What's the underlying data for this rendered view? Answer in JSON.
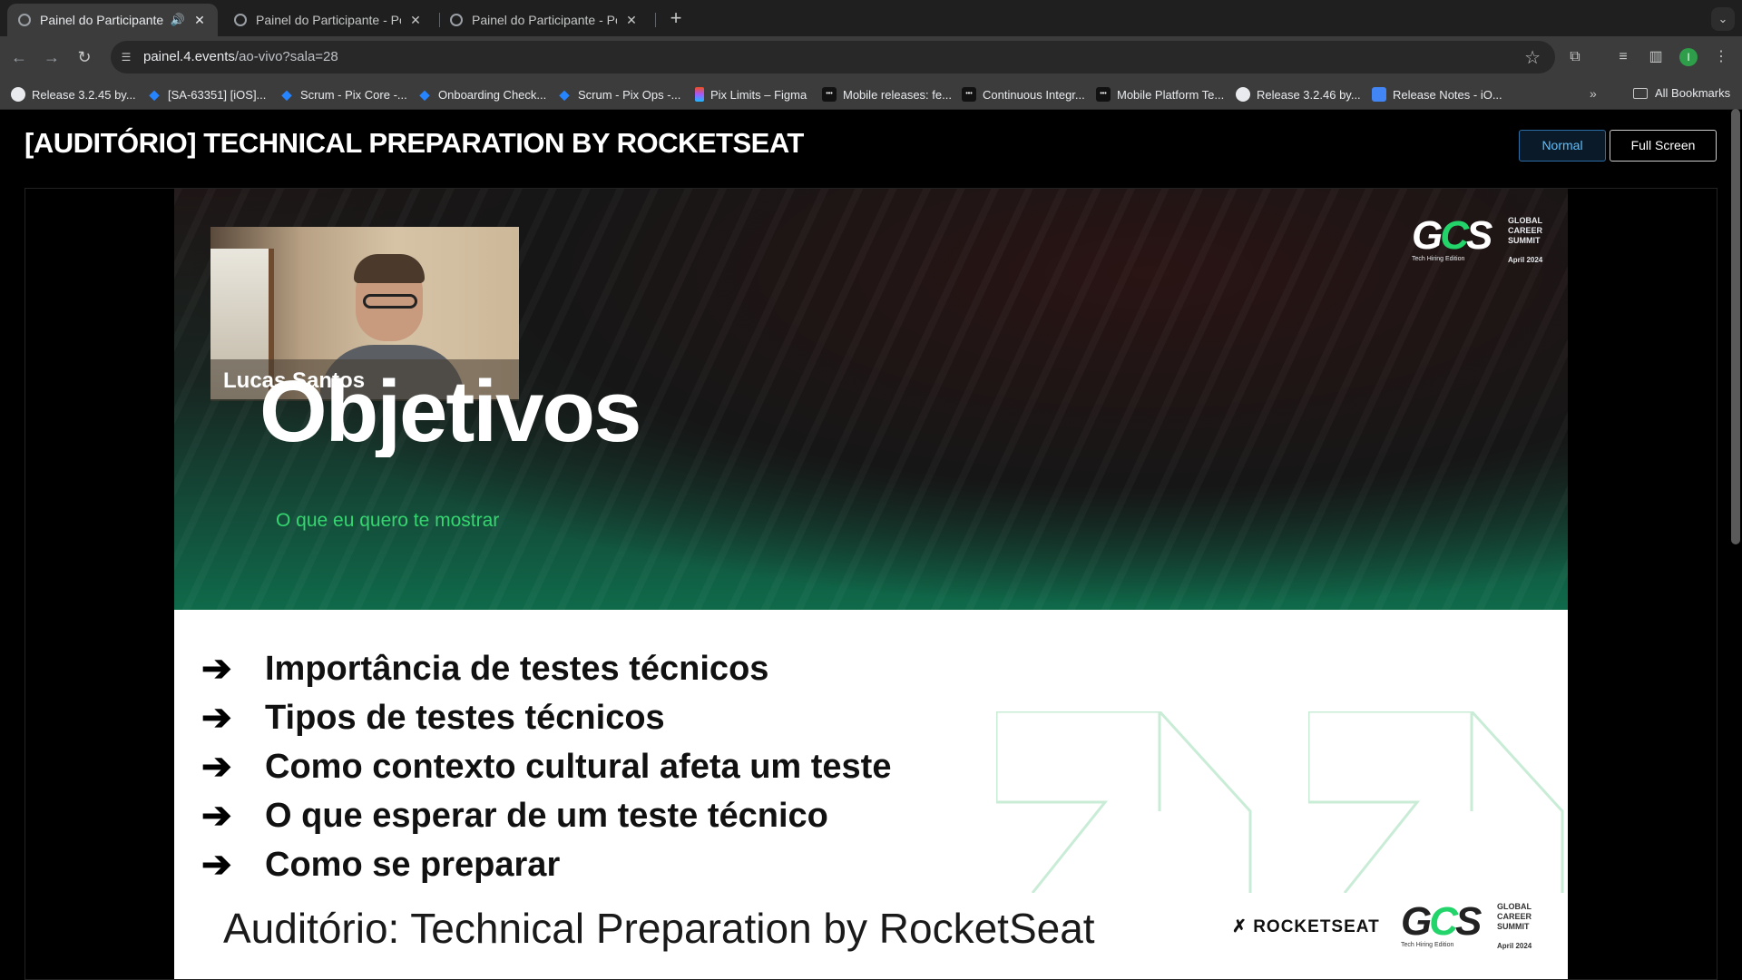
{
  "tabs": [
    {
      "title": "Painel do Participante - P",
      "active": true,
      "audio": true
    },
    {
      "title": "Painel do Participante - Powe",
      "active": false
    },
    {
      "title": "Painel do Participante - Powe",
      "active": false
    }
  ],
  "address": {
    "host": "painel.4.events",
    "path": "/ao-vivo?sala=28"
  },
  "profile_initial": "I",
  "bookmarks": [
    {
      "label": "Release 3.2.45 by...",
      "icon": "github-icon"
    },
    {
      "label": "[SA-63351] [iOS]...",
      "icon": "jira-icon"
    },
    {
      "label": "Scrum - Pix Core -...",
      "icon": "jira-icon"
    },
    {
      "label": "Onboarding Check...",
      "icon": "jira-icon"
    },
    {
      "label": "Scrum - Pix Ops -...",
      "icon": "jira-icon"
    },
    {
      "label": "Pix Limits – Figma",
      "icon": "figma-icon"
    },
    {
      "label": "Mobile releases: fe...",
      "icon": "app-icon"
    },
    {
      "label": "Continuous Integr...",
      "icon": "app-icon"
    },
    {
      "label": "Mobile Platform Te...",
      "icon": "app-icon"
    },
    {
      "label": "Release 3.2.46 by...",
      "icon": "github-icon"
    },
    {
      "label": "Release Notes - iO...",
      "icon": "docs-icon"
    }
  ],
  "all_bookmarks": "All Bookmarks",
  "page": {
    "title": "[AUDITÓRIO] TECHNICAL PREPARATION BY ROCKETSEAT",
    "btn_normal": "Normal",
    "btn_fullscreen": "Full Screen"
  },
  "slide": {
    "speaker": "Lucas Santos",
    "heading": "Objetivos",
    "subtitle": "O que eu quero te mostrar",
    "bullets": [
      "Importância de testes técnicos",
      "Tipos de testes técnicos",
      "Como contexto cultural afeta um teste",
      "O que esperar de um teste técnico",
      "Como se preparar"
    ],
    "footer": "Auditório: Technical Preparation by RocketSeat",
    "sponsor": "ROCKETSEAT",
    "logo": {
      "mark_g": "G",
      "mark_c": "C",
      "mark_s": "S",
      "line1": "GLOBAL",
      "line2": "CAREER",
      "line3": "SUMMIT",
      "edition": "Tech Hiring Edition",
      "date": "April 2024"
    },
    "arrow_glyph": "➔"
  },
  "colors": {
    "accent_green": "#35d66f",
    "button_blue": "#5bc0ff"
  }
}
